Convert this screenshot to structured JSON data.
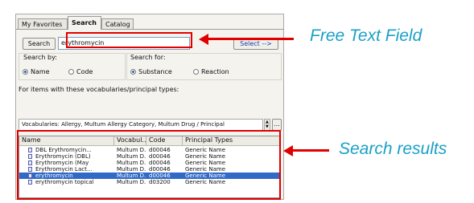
{
  "tabs": [
    "My Favorites",
    "Search",
    "Catalog"
  ],
  "active_tab": "Search",
  "search": {
    "button_label": "Search",
    "query": "erythromycin",
    "select_label": "Select -->"
  },
  "search_by": {
    "label": "Search by:",
    "options": [
      "Name",
      "Code"
    ],
    "selected": "Name"
  },
  "search_for": {
    "label": "Search for:",
    "options": [
      "Substance",
      "Reaction"
    ],
    "selected": "Substance"
  },
  "vocab_section": {
    "label": "For items with these vocabularies/principal types:",
    "value": "Vocabularies: Allergy, Multum Allergy Category, Multum Drug / Principal",
    "ellipsis_button": "..."
  },
  "results": {
    "columns": [
      "Name",
      "Vocabul...",
      "Code",
      "Principal Types"
    ],
    "rows": [
      {
        "name": "DBL Erythromycin...",
        "vocab": "Multum D...",
        "code": "d00046",
        "type": "Generic Name",
        "selected": false
      },
      {
        "name": "Erythromycin (DBL)",
        "vocab": "Multum D...",
        "code": "d00046",
        "type": "Generic Name",
        "selected": false
      },
      {
        "name": "Erythromycin (May",
        "vocab": "Multum D...",
        "code": "d00046",
        "type": "Generic Name",
        "selected": false
      },
      {
        "name": "Erythromycin Lact...",
        "vocab": "Multum D...",
        "code": "d00046",
        "type": "Generic Name",
        "selected": false
      },
      {
        "name": "erythromycin",
        "vocab": "Multum D...",
        "code": "d00046",
        "type": "Generic Name",
        "selected": true
      },
      {
        "name": "erythromycin topical",
        "vocab": "Multum D...",
        "code": "d03200",
        "type": "Generic Name",
        "selected": false
      }
    ]
  },
  "annotations": {
    "free_text": "Free Text Field",
    "search_results": "Search results",
    "color": "#e00000",
    "text_color": "#1aa0c8"
  }
}
